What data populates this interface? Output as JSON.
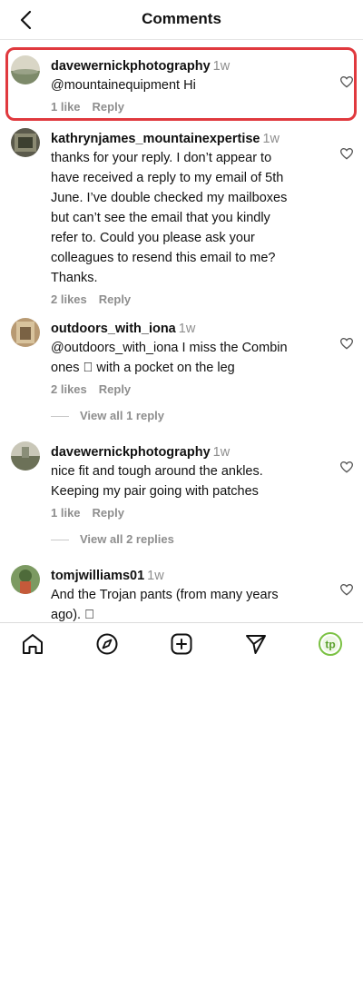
{
  "header": {
    "title": "Comments"
  },
  "comments": [
    {
      "username": "davewernickphotography",
      "time": "1w",
      "text": "@mountainequipment Hi",
      "likes": "1 like",
      "reply": "Reply"
    },
    {
      "username": "kathrynjames_mountainexpertise",
      "time": "1w",
      "lines": [
        "thanks for your reply. I don’t appear to",
        "have received a reply to my email of 5th",
        "June. I’ve double checked my mailboxes",
        "but can’t see the email that you kindly",
        "refer to. Could you please ask your",
        "colleagues to resend this email to me?",
        "Thanks."
      ],
      "likes": "2 likes",
      "reply": "Reply"
    },
    {
      "username": "outdoors_with_iona",
      "time": "1w",
      "lines": [
        "@outdoors_with_iona I miss the Combin",
        "ones ⃞ with a pocket on the leg"
      ],
      "likes": "2 likes",
      "reply": "Reply",
      "view_replies": "View all 1 reply"
    },
    {
      "username": "davewernickphotography",
      "time": "1w",
      "lines": [
        "nice fit and tough around the ankles.",
        "Keeping my pair going with patches"
      ],
      "likes": "1 like",
      "reply": "Reply",
      "view_replies": "View all 2 replies"
    },
    {
      "username": "tomjwilliams01",
      "time": "1w",
      "lines": [
        "And the Trojan pants (from many years",
        "ago). ⃞"
      ]
    }
  ],
  "nav": {
    "icons": [
      "home-icon",
      "explore-icon",
      "create-icon",
      "direct-icon",
      "profile-avatar"
    ],
    "profile_initials": "tp"
  },
  "colors": {
    "highlight": "#e0393e",
    "profile_ring": "#7ac142",
    "secondary_text": "#8e8e8e"
  }
}
